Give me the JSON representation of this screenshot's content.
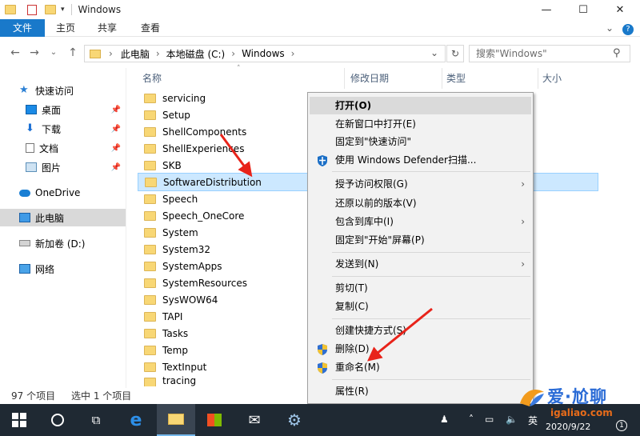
{
  "window": {
    "title": "Windows",
    "minimize": "—",
    "maximize": "☐",
    "close": "✕"
  },
  "ribbon": {
    "tabs": [
      "文件",
      "主页",
      "共享",
      "查看"
    ],
    "expand": "⌄",
    "help": "?"
  },
  "address": {
    "path": [
      "此电脑",
      "本地磁盘 (C:)",
      "Windows"
    ],
    "refresh": "↻",
    "dropdown": "⌄"
  },
  "search": {
    "placeholder": "搜索\"Windows\"",
    "icon": "search-icon"
  },
  "sidebar": {
    "items": [
      {
        "label": "快速访问",
        "icon": "star-icon"
      },
      {
        "label": "桌面",
        "icon": "desktop-icon",
        "pinned": true
      },
      {
        "label": "下载",
        "icon": "download-icon",
        "pinned": true
      },
      {
        "label": "文档",
        "icon": "document-icon",
        "pinned": true
      },
      {
        "label": "图片",
        "icon": "pictures-icon",
        "pinned": true
      },
      {
        "label": "OneDrive",
        "icon": "cloud-icon"
      },
      {
        "label": "此电脑",
        "icon": "computer-icon"
      },
      {
        "label": "新加卷 (D:)",
        "icon": "drive-icon"
      },
      {
        "label": "网络",
        "icon": "network-icon"
      }
    ]
  },
  "columns": {
    "name": "名称",
    "modified": "修改日期",
    "type": "类型",
    "size": "大小"
  },
  "files": [
    "servicing",
    "Setup",
    "ShellComponents",
    "ShellExperiences",
    "SKB",
    "SoftwareDistribution",
    "Speech",
    "Speech_OneCore",
    "System",
    "System32",
    "SystemApps",
    "SystemResources",
    "SysWOW64",
    "TAPI",
    "Tasks",
    "Temp",
    "TextInput",
    "tracing"
  ],
  "status": {
    "count": "97 个项目",
    "selected": "选中 1 个项目"
  },
  "context_menu": {
    "items": [
      {
        "label": "打开(O)"
      },
      {
        "label": "在新窗口中打开(E)"
      },
      {
        "label": "固定到\"快速访问\""
      },
      {
        "label": "使用 Windows Defender扫描..."
      },
      {
        "label": "授予访问权限(G)"
      },
      {
        "label": "还原以前的版本(V)"
      },
      {
        "label": "包含到库中(I)"
      },
      {
        "label": "固定到\"开始\"屏幕(P)"
      },
      {
        "label": "发送到(N)"
      },
      {
        "label": "剪切(T)"
      },
      {
        "label": "复制(C)"
      },
      {
        "label": "创建快捷方式(S)"
      },
      {
        "label": "删除(D)"
      },
      {
        "label": "重命名(M)"
      },
      {
        "label": "属性(R)"
      }
    ],
    "submenu_arrow": "›"
  },
  "taskbar": {
    "tray_lang": "英",
    "date": "2020/9/22",
    "notifications": "1"
  },
  "watermark": {
    "brand": "爱·尬聊",
    "site": "igaliao.com"
  },
  "colors": {
    "accent": "#1979ca",
    "selection": "#cce8ff",
    "arrow": "#e8231a",
    "taskbar": "#1f2933"
  }
}
